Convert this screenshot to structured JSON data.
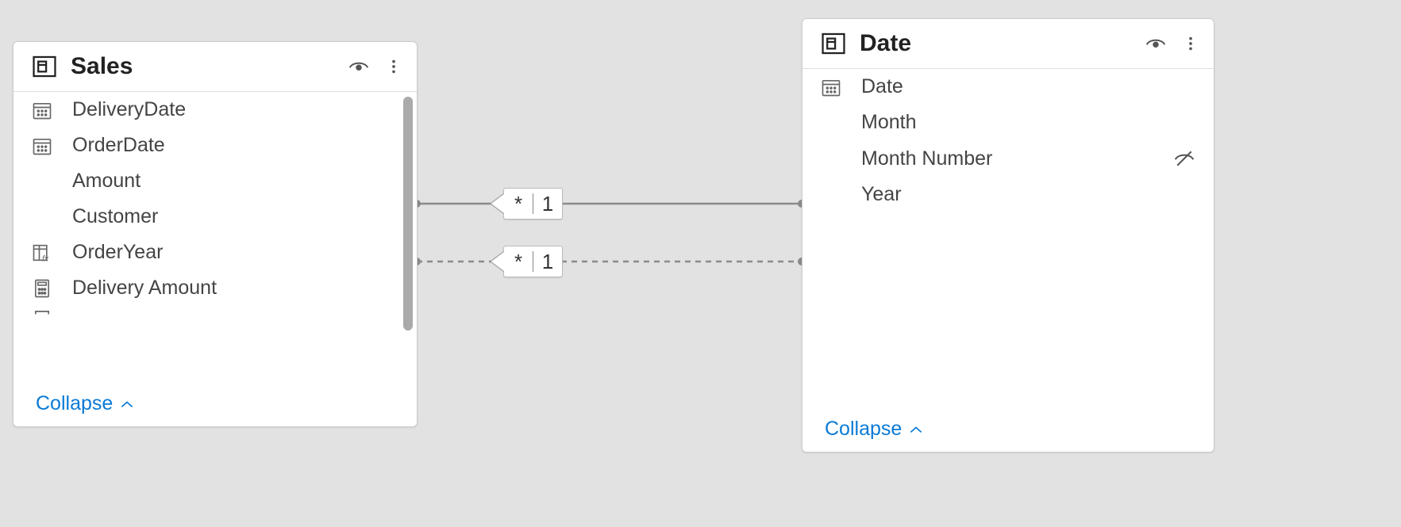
{
  "tables": {
    "sales": {
      "title": "Sales",
      "footer": "Collapse",
      "fields": [
        {
          "name": "DeliveryDate",
          "icon": "calendar",
          "hidden": false
        },
        {
          "name": "OrderDate",
          "icon": "calendar",
          "hidden": false
        },
        {
          "name": "Amount",
          "icon": "",
          "hidden": false
        },
        {
          "name": "Customer",
          "icon": "",
          "hidden": false
        },
        {
          "name": "OrderYear",
          "icon": "calc-column",
          "hidden": false
        },
        {
          "name": "Delivery Amount",
          "icon": "measure",
          "hidden": false
        }
      ]
    },
    "date": {
      "title": "Date",
      "footer": "Collapse",
      "fields": [
        {
          "name": "Date",
          "icon": "calendar",
          "hidden": false
        },
        {
          "name": "Month",
          "icon": "",
          "hidden": false
        },
        {
          "name": "Month Number",
          "icon": "",
          "hidden": true
        },
        {
          "name": "Year",
          "icon": "",
          "hidden": false
        }
      ]
    }
  },
  "relationships": [
    {
      "left": "*",
      "right": "1",
      "style": "solid"
    },
    {
      "left": "*",
      "right": "1",
      "style": "dashed"
    }
  ]
}
